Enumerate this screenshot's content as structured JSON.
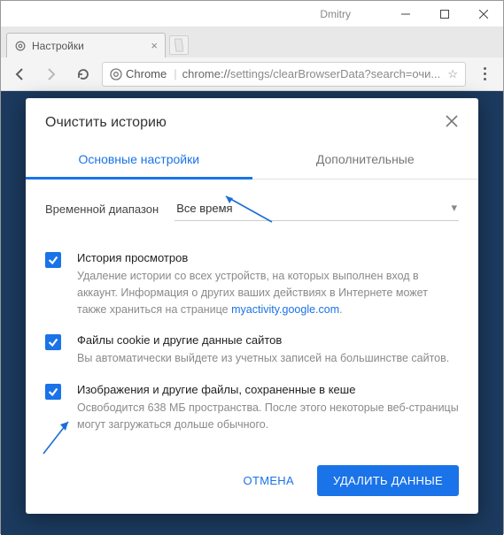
{
  "window": {
    "user": "Dmitry"
  },
  "tab": {
    "title": "Настройки"
  },
  "omnibox": {
    "chip": "Chrome",
    "scheme": "chrome://",
    "path": "settings/clearBrowserData?search=очи..."
  },
  "dialog": {
    "title": "Очистить историю",
    "tabs": {
      "basic": "Основные настройки",
      "advanced": "Дополнительные",
      "active": "basic"
    },
    "timerange": {
      "label": "Временной диапазон",
      "value": "Все время"
    },
    "options": [
      {
        "title": "История просмотров",
        "desc_pre": "Удаление истории со всех устройств, на которых выполнен вход в аккаунт. Информация о других ваших действиях в Интернете может также храниться на странице ",
        "link": "myactivity.google.com",
        "desc_post": ".",
        "checked": true
      },
      {
        "title": "Файлы cookie и другие данные сайтов",
        "desc": "Вы автоматически выйдете из учетных записей на большинстве сайтов.",
        "checked": true
      },
      {
        "title": "Изображения и другие файлы, сохраненные в кеше",
        "desc": "Освободится 638 МБ пространства. После этого некоторые веб-страницы могут загружаться дольше обычного.",
        "checked": true
      }
    ],
    "actions": {
      "cancel": "ОТМЕНА",
      "confirm": "УДАЛИТЬ ДАННЫЕ"
    }
  }
}
